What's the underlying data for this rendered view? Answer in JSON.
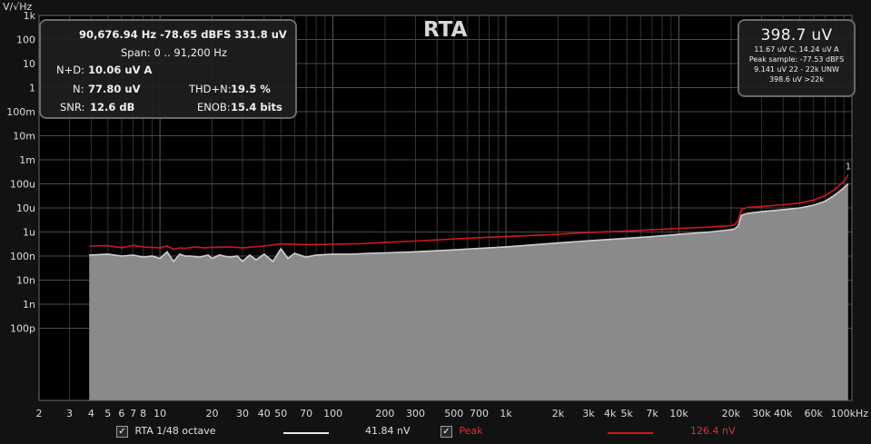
{
  "chart_data": {
    "type": "area",
    "title": "RTA",
    "ylabel": "V/√Hz",
    "xlabel": "",
    "x_scale": "log",
    "y_scale": "log",
    "xlim": [
      2,
      100000
    ],
    "ylim": [
      1e-13,
      1000
    ],
    "grid": true,
    "x_ticks": [
      {
        "v": 2,
        "label": "2"
      },
      {
        "v": 3,
        "label": "3"
      },
      {
        "v": 4,
        "label": "4"
      },
      {
        "v": 5,
        "label": "5"
      },
      {
        "v": 6,
        "label": "6"
      },
      {
        "v": 7,
        "label": "7"
      },
      {
        "v": 8,
        "label": "8"
      },
      {
        "v": 10,
        "label": "10"
      },
      {
        "v": 20,
        "label": "20"
      },
      {
        "v": 30,
        "label": "30"
      },
      {
        "v": 40,
        "label": "40"
      },
      {
        "v": 50,
        "label": "50"
      },
      {
        "v": 70,
        "label": "70"
      },
      {
        "v": 100,
        "label": "100"
      },
      {
        "v": 200,
        "label": "200"
      },
      {
        "v": 300,
        "label": "300"
      },
      {
        "v": 500,
        "label": "500"
      },
      {
        "v": 700,
        "label": "700"
      },
      {
        "v": 1000,
        "label": "1k"
      },
      {
        "v": 2000,
        "label": "2k"
      },
      {
        "v": 3000,
        "label": "3k"
      },
      {
        "v": 4000,
        "label": "4k"
      },
      {
        "v": 5000,
        "label": "5k"
      },
      {
        "v": 7000,
        "label": "7k"
      },
      {
        "v": 10000,
        "label": "10k"
      },
      {
        "v": 20000,
        "label": "20k"
      },
      {
        "v": 30000,
        "label": "30k"
      },
      {
        "v": 40000,
        "label": "40k"
      },
      {
        "v": 60000,
        "label": "60k"
      },
      {
        "v": 100000,
        "label": "100kHz"
      }
    ],
    "y_ticks": [
      {
        "v": 1000,
        "label": "1k"
      },
      {
        "v": 100,
        "label": "100"
      },
      {
        "v": 10,
        "label": "10"
      },
      {
        "v": 1,
        "label": "1"
      },
      {
        "v": 0.1,
        "label": "100m"
      },
      {
        "v": 0.01,
        "label": "10m"
      },
      {
        "v": 0.001,
        "label": "1m"
      },
      {
        "v": 0.0001,
        "label": "100u"
      },
      {
        "v": 1e-05,
        "label": "10u"
      },
      {
        "v": 1e-06,
        "label": "1u"
      },
      {
        "v": 1e-07,
        "label": "100n"
      },
      {
        "v": 1e-08,
        "label": "10n"
      },
      {
        "v": 1e-09,
        "label": "1n"
      },
      {
        "v": 1e-10,
        "label": "100p"
      }
    ],
    "series": [
      {
        "name": "RTA 1/48 octave",
        "color": "#d0d0d0",
        "fill": "#8a8a8a",
        "x": [
          3.9,
          5,
          6,
          7,
          8,
          9,
          10,
          11,
          12,
          13,
          14,
          15,
          17,
          19,
          20,
          22,
          25,
          28,
          30,
          33,
          36,
          40,
          45,
          50,
          55,
          60,
          70,
          80,
          100,
          130,
          160,
          200,
          300,
          500,
          700,
          1000,
          2000,
          3000,
          5000,
          7000,
          10000,
          15000,
          20000,
          21000,
          22000,
          23000,
          25000,
          30000,
          40000,
          50000,
          60000,
          70000,
          80000,
          90000,
          95000
        ],
        "y": [
          1.1e-07,
          1.2e-07,
          1e-07,
          1.1e-07,
          9e-08,
          1e-07,
          8e-08,
          1.5e-07,
          6e-08,
          1.2e-07,
          1e-07,
          1e-07,
          9e-08,
          1.1e-07,
          8e-08,
          1.1e-07,
          9e-08,
          1e-07,
          6e-08,
          1.1e-07,
          7e-08,
          1.2e-07,
          6e-08,
          2e-07,
          8e-08,
          1.3e-07,
          9e-08,
          1.1e-07,
          1.2e-07,
          1.2e-07,
          1.3e-07,
          1.35e-07,
          1.5e-07,
          1.8e-07,
          2.1e-07,
          2.4e-07,
          3.5e-07,
          4.3e-07,
          5.5e-07,
          6.5e-07,
          8e-07,
          1e-06,
          1.25e-06,
          1.35e-06,
          1.8e-06,
          5e-06,
          6e-06,
          7e-06,
          8.5e-06,
          1e-05,
          1.3e-05,
          1.9e-05,
          3.5e-05,
          7e-05,
          0.0001
        ]
      },
      {
        "name": "Peak",
        "color": "#d01818",
        "x": [
          3.9,
          5,
          6,
          7,
          8,
          9,
          10,
          11,
          12,
          13,
          14,
          16,
          18,
          20,
          25,
          30,
          40,
          50,
          70,
          100,
          150,
          200,
          300,
          500,
          700,
          1000,
          2000,
          3000,
          5000,
          10000,
          15000,
          20000,
          21000,
          22000,
          23000,
          25000,
          30000,
          40000,
          50000,
          60000,
          70000,
          80000,
          90000,
          95000
        ],
        "y": [
          2.6e-07,
          2.7e-07,
          2.2e-07,
          2.8e-07,
          2.4e-07,
          2.3e-07,
          2.2e-07,
          2.6e-07,
          1.9e-07,
          2.2e-07,
          2.1e-07,
          2.4e-07,
          2.2e-07,
          2.3e-07,
          2.4e-07,
          2.2e-07,
          2.6e-07,
          3.2e-07,
          3e-07,
          3.1e-07,
          3.3e-07,
          3.7e-07,
          4.2e-07,
          5.1e-07,
          5.8e-07,
          6.4e-07,
          8e-07,
          9.5e-07,
          1.1e-06,
          1.4e-06,
          1.6e-06,
          1.85e-06,
          2e-06,
          3e-06,
          9e-06,
          1.05e-05,
          1.15e-05,
          1.35e-05,
          1.6e-05,
          2.1e-05,
          3.2e-05,
          6e-05,
          0.00013,
          0.00024
        ]
      }
    ],
    "annotations": [
      {
        "text": "1",
        "x": 95000,
        "y": 0.00024
      }
    ]
  },
  "measurements": {
    "line1": "90,676.94 Hz  -78.65 dBFS  331.8 uV",
    "span": "Span: 0 .. 91,200 Hz",
    "n_d_label": "N+D:",
    "n_d_value": "10.06 uV A",
    "n_label": "N:",
    "n_value": "77.80 uV",
    "thdn_label": "THD+N:",
    "thdn_value": "19.5 %",
    "snr_label": "SNR:",
    "snr_value": "12.6 dB",
    "enob_label": "ENOB:",
    "enob_value": "15.4 bits"
  },
  "level": {
    "main": "398.7 uV",
    "lines": [
      "11.67 uV C, 14.24 uV A",
      "Peak sample: -77.53 dBFS",
      "9.141 uV 22 - 22k UNW",
      "398.6 uV >22k"
    ]
  },
  "legend": {
    "rta_label": "RTA 1/48 octave",
    "rta_value": "41.84 nV",
    "rta_checked": "✓",
    "peak_label": "Peak",
    "peak_value": "126.4 nV",
    "peak_checked": "✓"
  }
}
